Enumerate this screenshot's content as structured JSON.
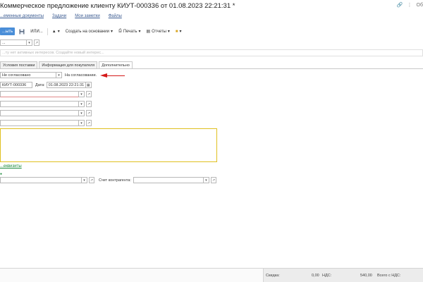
{
  "window": {
    "title": "Коммерческое предложение клиенту КИУТ-000336 от 01.08.2023 22:21:31 *",
    "right_label": "Об"
  },
  "top_links": [
    "...еменные документы",
    "Задачи",
    "Мои заметки",
    "Файлы"
  ],
  "toolbar": {
    "primary_label": "...ыть",
    "ili_label": "ИЛИ...",
    "create_basis_label": "Создать на основании",
    "print_label": "Печать",
    "reports_label": "Отчеты"
  },
  "top_field_value": "...",
  "comment": {
    "placeholder": "...ту нет активных интересов. Создайте новый интерес..."
  },
  "tabs": [
    "Условия поставки",
    "Информация для покупателя",
    "Дополнительно"
  ],
  "tab_active_index": 2,
  "status": {
    "select_value": "Не согласовано",
    "status_text": "На согласовании."
  },
  "doc": {
    "number": "КИУТ-000336",
    "date_label": "Дата:",
    "date_value": "01.08.2023 22:21:31"
  },
  "requisites_link": "...еквизиты",
  "counterparty": {
    "account_label": "Счет контрагента:"
  },
  "footer": {
    "discount_label": "Скидка:",
    "discount_value": "0,00",
    "vat_label": "НДС:",
    "vat_value": "540,00",
    "total_vat_label": "Всего с НДС:"
  },
  "colors": {
    "primary_button": "#4a8ed8",
    "link": "#3b5b91",
    "annotation_arrow": "#d41a1a",
    "highlight_border": "#e0c020",
    "green_link": "#1a8a3a"
  }
}
